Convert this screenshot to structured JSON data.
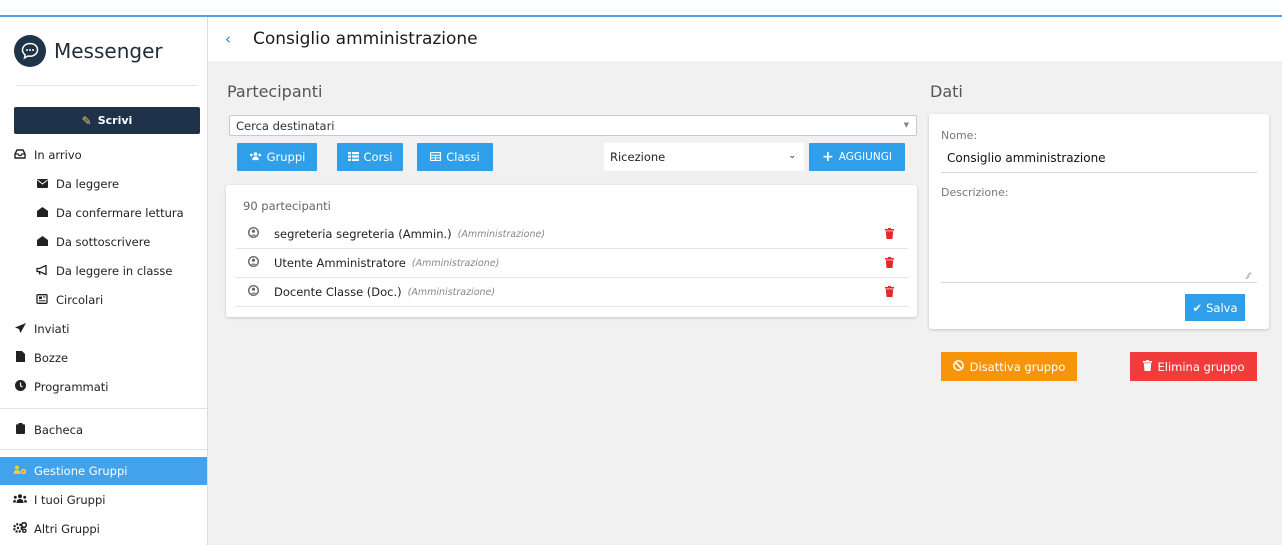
{
  "app": {
    "name": "Messenger",
    "logo_icon": "chat-bubble-icon",
    "accent_color": "#42a3ec",
    "dark_color": "#1e334a"
  },
  "sidebar": {
    "write_label": "Scrivi",
    "items": [
      {
        "label": "In arrivo",
        "icon": "inbox-icon"
      },
      {
        "label": "Da leggere",
        "icon": "envelope-icon"
      },
      {
        "label": "Da confermare lettura",
        "icon": "envelope-open-icon"
      },
      {
        "label": "Da sottoscrivere",
        "icon": "envelope-open-icon"
      },
      {
        "label": "Da leggere in classe",
        "icon": "megaphone-icon"
      },
      {
        "label": "Circolari",
        "icon": "newspaper-icon"
      },
      {
        "label": "Inviati",
        "icon": "paper-plane-icon"
      },
      {
        "label": "Bozze",
        "icon": "file-icon"
      },
      {
        "label": "Programmati",
        "icon": "clock-icon"
      },
      {
        "label": "Bacheca",
        "icon": "clipboard-icon"
      },
      {
        "label": "Gestione Gruppi",
        "icon": "users-cog-icon",
        "active": true
      },
      {
        "label": "I tuoi Gruppi",
        "icon": "users-icon"
      },
      {
        "label": "Altri Gruppi",
        "icon": "cogs-icon"
      }
    ]
  },
  "header": {
    "title": "Consiglio amministrazione"
  },
  "participants": {
    "title": "Partecipanti",
    "search_placeholder": "Cerca destinatari",
    "buttons": {
      "groups": "Gruppi",
      "courses": "Corsi",
      "classes": "Classi",
      "add": "AGGIUNGI"
    },
    "reception_value": "Ricezione",
    "count_label": "90 partecipanti",
    "rows": [
      {
        "name": "segreteria segreteria (Ammin.)",
        "role": "(Amministrazione)"
      },
      {
        "name": "Utente Amministratore",
        "role": "(Amministrazione)"
      },
      {
        "name": "Docente Classe (Doc.)",
        "role": "(Amministrazione)"
      }
    ]
  },
  "data_panel": {
    "title": "Dati",
    "name_label": "Nome:",
    "name_value": "Consiglio amministrazione",
    "description_label": "Descrizione:",
    "save_label": "Salva"
  },
  "actions": {
    "deactivate_label": "Disattiva gruppo",
    "deactivate_color": "#f7940a",
    "delete_label": "Elimina gruppo",
    "delete_color": "#f23b3b"
  }
}
